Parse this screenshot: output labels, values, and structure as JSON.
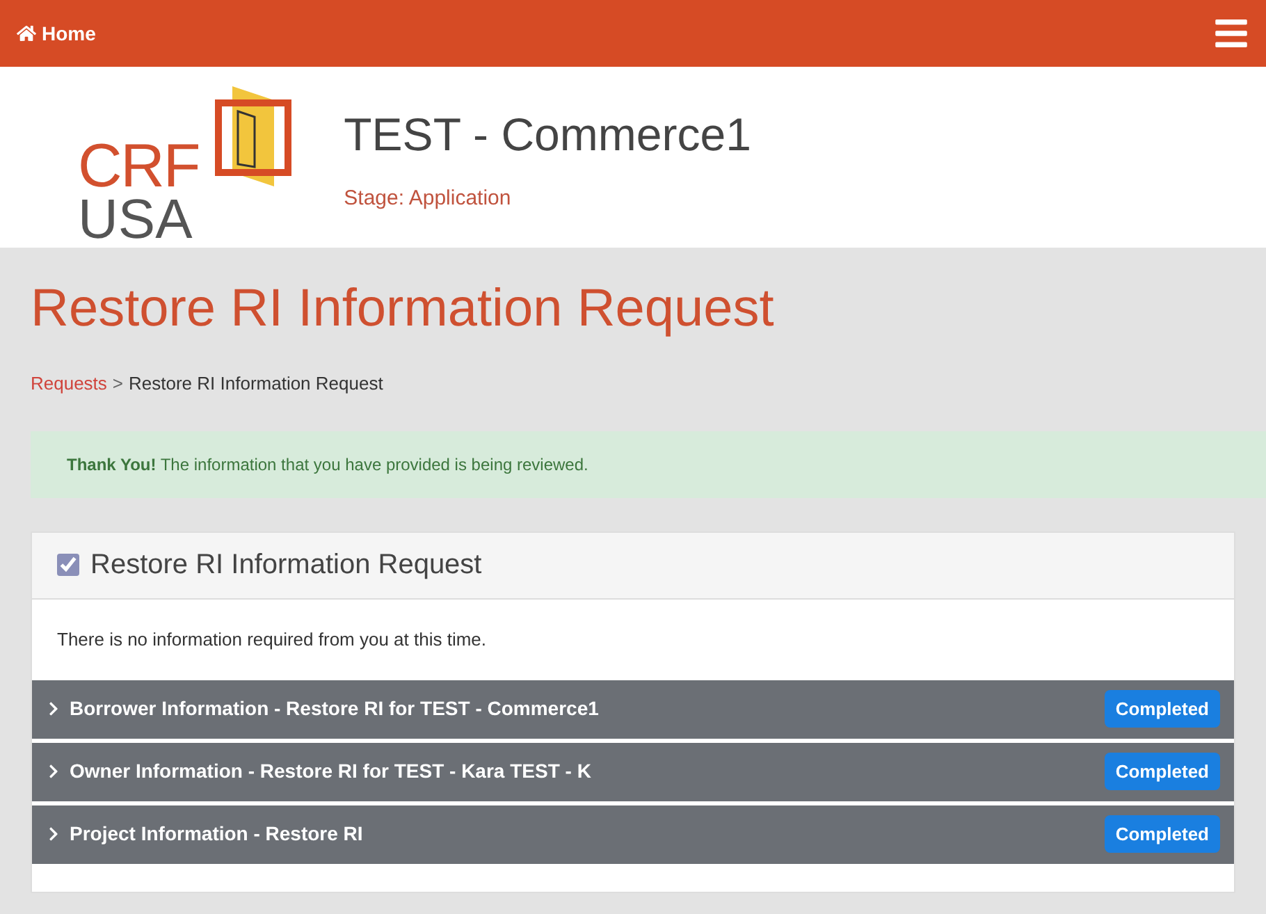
{
  "nav": {
    "home": "Home"
  },
  "header": {
    "logo_top": "CRF",
    "logo_bottom": "USA",
    "title": "TEST - Commerce1",
    "stage": "Stage: Application"
  },
  "page_title": "Restore RI Information Request",
  "breadcrumb": {
    "link": "Requests",
    "separator": ">",
    "current": "Restore RI Information Request"
  },
  "alert": "**Thank You!** The information that you have provided is being reviewed.",
  "panel": {
    "title": "Restore RI Information Request",
    "checked": true,
    "message": "There is no information required from you at this time.",
    "sections": [
      {
        "label": "Borrower Information - Restore RI for TEST - Commerce1",
        "status": "Completed",
        "expanded": false
      },
      {
        "label": "Owner Information - Restore RI for TEST - Kara TEST - K",
        "status": "Completed",
        "expanded": false
      },
      {
        "label": "Project Information - Restore RI",
        "status": "Completed",
        "expanded": false
      }
    ]
  }
}
